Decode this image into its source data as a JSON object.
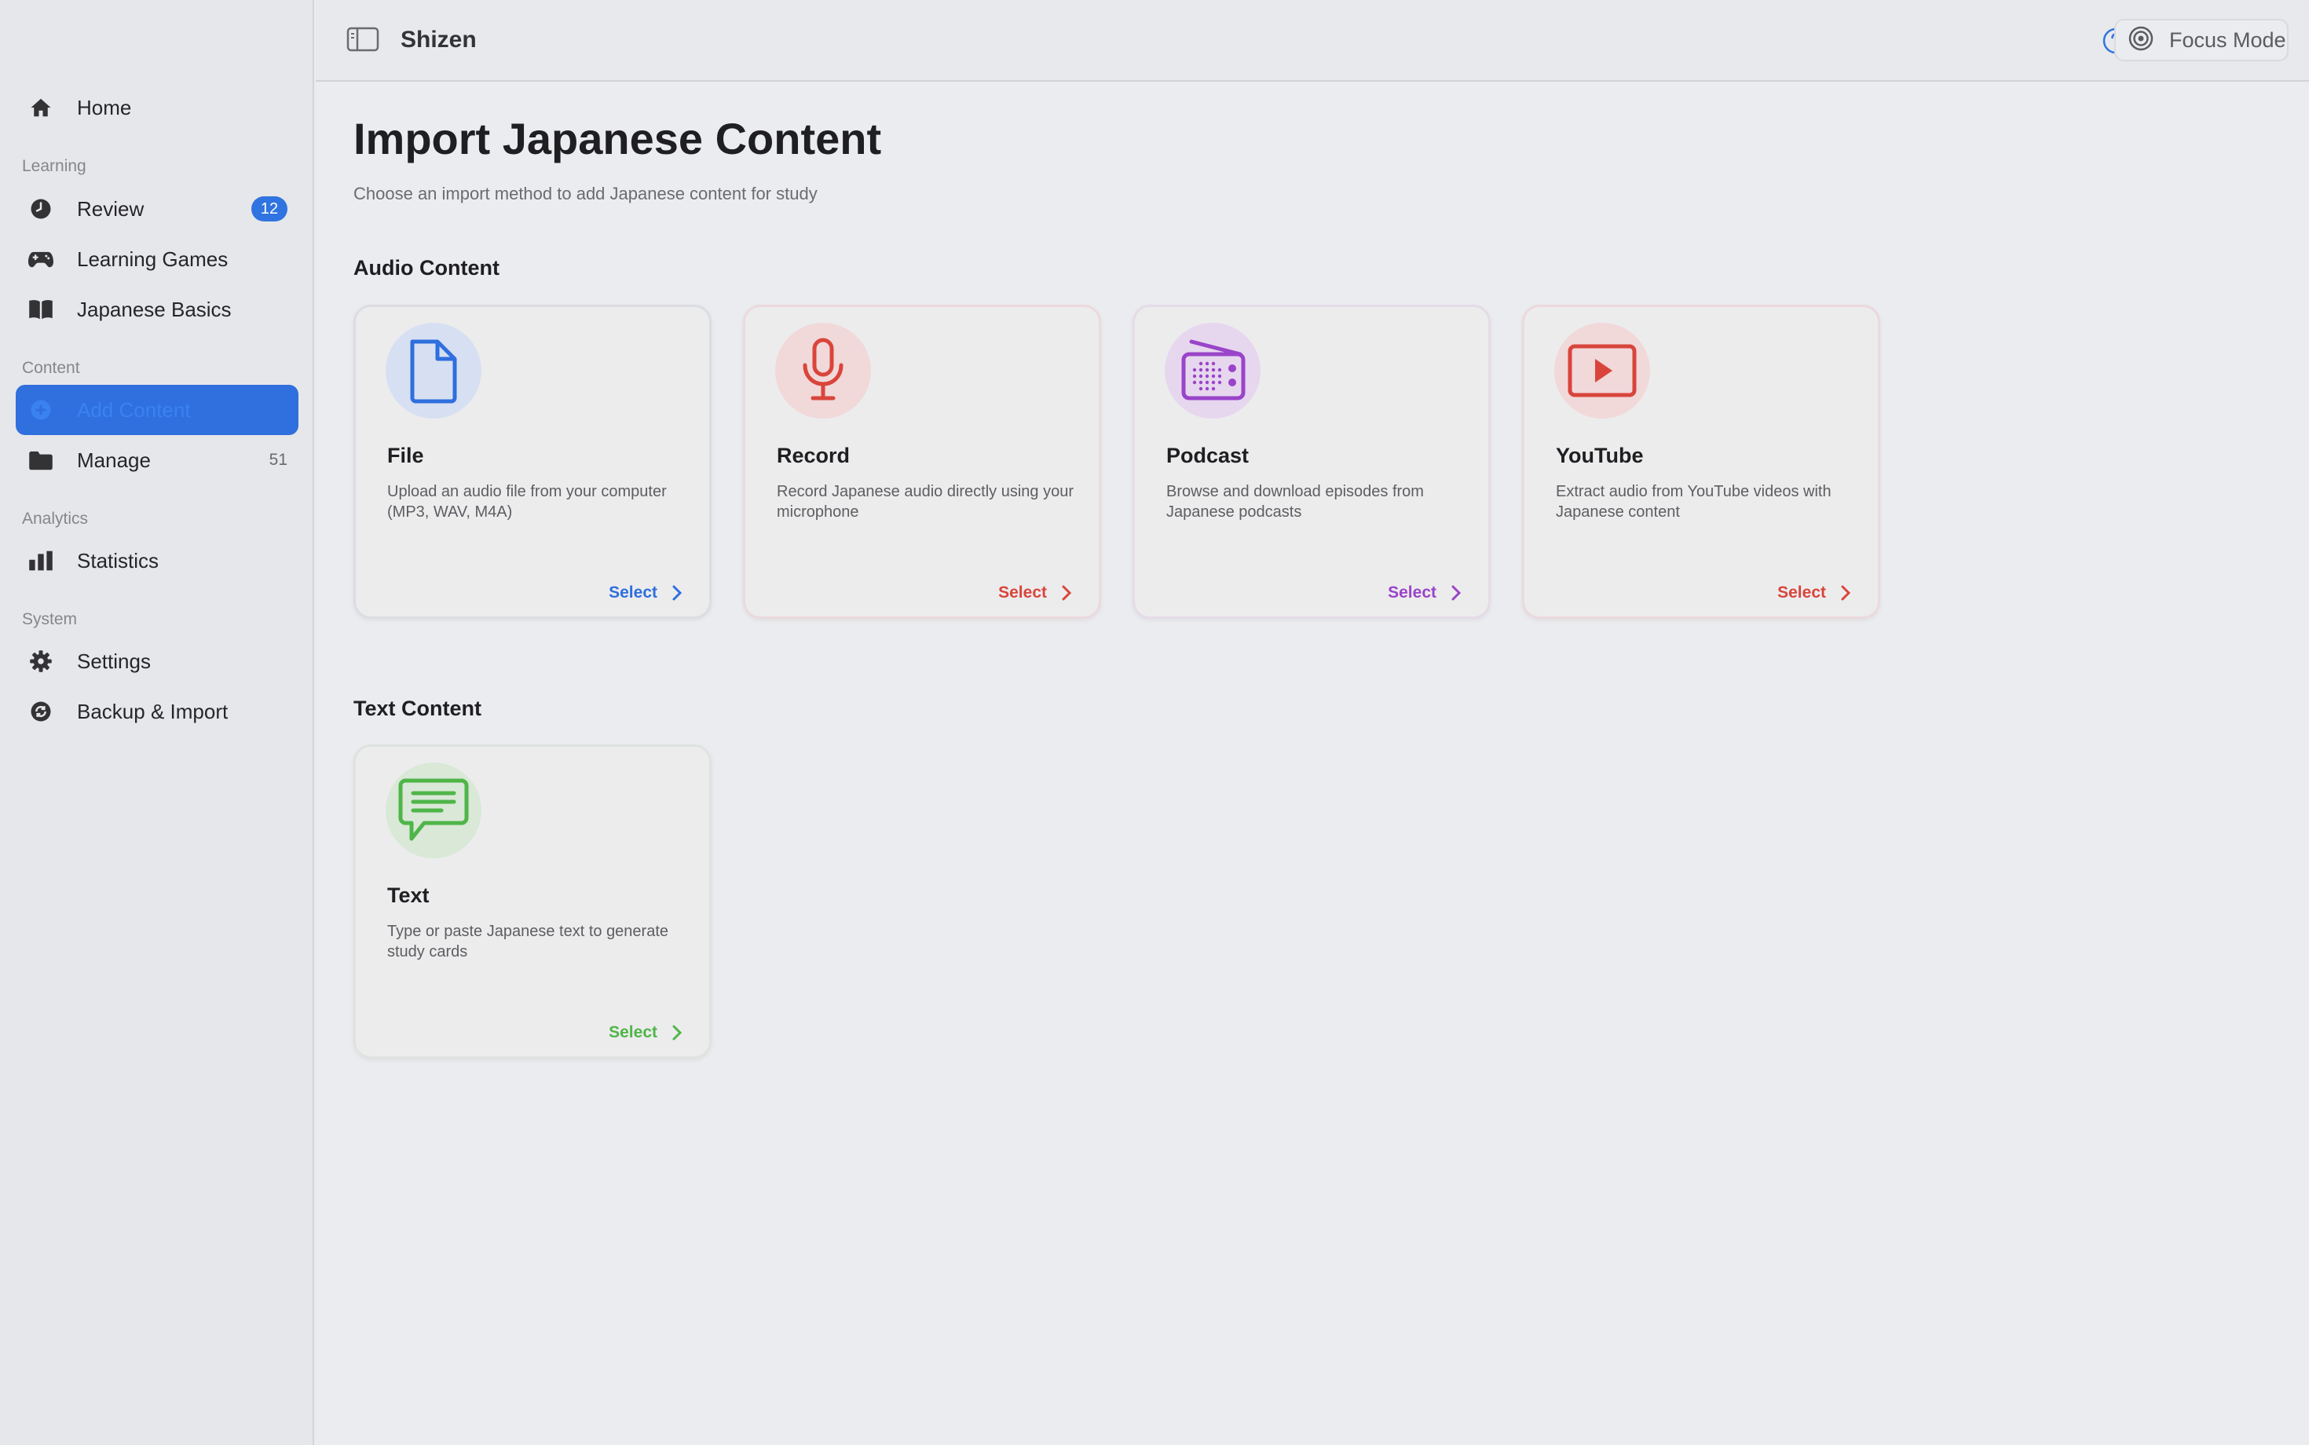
{
  "app": {
    "title": "Shizen"
  },
  "topbar": {
    "focus_label": "Focus Mode"
  },
  "sidebar": {
    "home": {
      "label": "Home"
    },
    "sections": {
      "learning": "Learning",
      "content": "Content",
      "analytics": "Analytics",
      "system": "System"
    },
    "review": {
      "label": "Review",
      "badge": "12"
    },
    "games": {
      "label": "Learning Games"
    },
    "basics": {
      "label": "Japanese Basics"
    },
    "add_content": {
      "label": "Add Content"
    },
    "manage": {
      "label": "Manage",
      "count": "51"
    },
    "statistics": {
      "label": "Statistics"
    },
    "settings": {
      "label": "Settings"
    },
    "backup": {
      "label": "Backup & Import"
    }
  },
  "main": {
    "title": "Import Japanese Content",
    "subtitle": "Choose an import method to add Japanese content for study",
    "audio_section": "Audio Content",
    "text_section": "Text Content",
    "select_label": "Select",
    "cards": {
      "file": {
        "title": "File",
        "desc": "Upload an audio file from your computer (MP3, WAV, M4A)",
        "color": "#2f6fde"
      },
      "record": {
        "title": "Record",
        "desc": "Record Japanese audio directly using your microphone",
        "color": "#d9453b"
      },
      "podcast": {
        "title": "Podcast",
        "desc": "Browse and download episodes from Japanese podcasts",
        "color": "#9a44c9"
      },
      "youtube": {
        "title": "YouTube",
        "desc": "Extract audio from YouTube videos with Japanese content",
        "color": "#d9453b"
      },
      "text": {
        "title": "Text",
        "desc": "Type or paste Japanese text to generate study cards",
        "color": "#4fb548"
      }
    }
  }
}
